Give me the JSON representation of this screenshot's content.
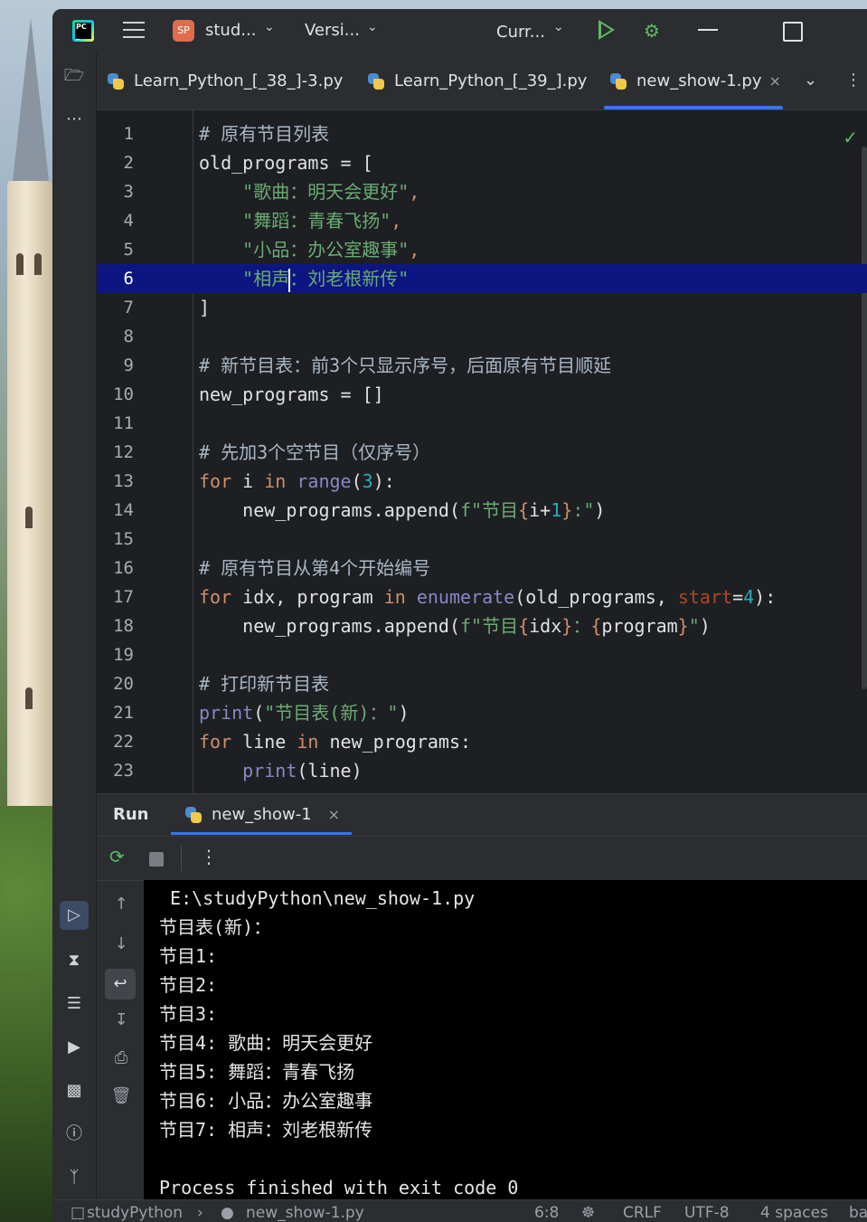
{
  "titlebar": {
    "project_badge": "SP",
    "project_name": "stud...",
    "vcs": "Versi...",
    "run_config": "Curr..."
  },
  "tabs": [
    {
      "label": "Learn_Python_[_38_]-3.py"
    },
    {
      "label": "Learn_Python_[_39_].py"
    },
    {
      "label": "new_show-1.py",
      "close": "×"
    }
  ],
  "editor": {
    "line_numbers": [
      "1",
      "2",
      "3",
      "4",
      "5",
      "6",
      "7",
      "8",
      "9",
      "10",
      "11",
      "12",
      "13",
      "14",
      "15",
      "16",
      "17",
      "18",
      "19",
      "20",
      "21",
      "22",
      "23"
    ],
    "current_line": 6,
    "code": {
      "l1_comment": "# 原有节目列表",
      "l2_a": "old_programs = [",
      "l3": "\"歌曲：明天会更好\"",
      "l3_comma": ",",
      "l4": "\"舞蹈：青春飞扬\"",
      "l4_comma": ",",
      "l5": "\"小品：办公室趣事\"",
      "l5_comma": ",",
      "l6_a": "\"相声",
      "l6_b": "：刘老根新传\"",
      "l7": "]",
      "l9_comment": "# 新节目表：前3个只显示序号，后面原有节目顺延",
      "l10": "new_programs = []",
      "l12_comment": "# 先加3个空节目（仅序号）",
      "l13_kw": "for",
      "l13_var": " i ",
      "l13_in": "in",
      "l13_sp": " ",
      "l13_range": "range",
      "l13_open": "(",
      "l13_num": "3",
      "l13_close": "):",
      "l14_call": "new_programs.append(",
      "l14_f": "f\"节目",
      "l14_brace_open": "{",
      "l14_expr": "i+",
      "l14_num": "1",
      "l14_brace_close": "}",
      "l14_end": ":\"",
      "l14_paren": ")",
      "l16_comment": "# 原有节目从第4个开始编号",
      "l17_kw": "for",
      "l17_vars": " idx, program ",
      "l17_in": "in",
      "l17_sp": " ",
      "l17_enum": "enumerate",
      "l17_args": "(old_programs, ",
      "l17_param": "start",
      "l17_eq": "=",
      "l17_num": "4",
      "l17_close": "):",
      "l18_call": "new_programs.append(",
      "l18_f": "f\"节目",
      "l18_b1": "{",
      "l18_e1": "idx",
      "l18_b2": "}",
      "l18_colon": "：",
      "l18_b3": "{",
      "l18_e2": "program",
      "l18_b4": "}",
      "l18_q": "\"",
      "l18_paren": ")",
      "l20_comment": "# 打印新节目表",
      "l21_print": "print",
      "l21_open": "(",
      "l21_str": "\"节目表(新)：\"",
      "l21_close": ")",
      "l22_kw": "for",
      "l22_var": " line ",
      "l22_in": "in",
      "l22_rest": " new_programs:",
      "l23_print": "print",
      "l23_args": "(line)"
    }
  },
  "run": {
    "title": "Run",
    "tab_label": "new_show-1",
    "tab_close": "×",
    "output": [
      " E:\\studyPython\\new_show-1.py",
      "节目表(新)：",
      "节目1:",
      "节目2:",
      "节目3:",
      "节目4: 歌曲：明天会更好",
      "节目5: 舞蹈：青春飞扬",
      "节目6: 小品：办公室趣事",
      "节目7: 相声：刘老根新传",
      "",
      "Process finished with exit code 0"
    ]
  },
  "statusbar": {
    "project": "studyPython",
    "file": "new_show-1.py",
    "position": "6:8",
    "line_sep": "CRLF",
    "encoding": "UTF-8",
    "indent": "4 spaces",
    "extra": "ba"
  },
  "colors": {
    "accent": "#3574f0",
    "current_line": "#0d1680",
    "keyword": "#cf8e6d",
    "string": "#6aab73",
    "number": "#2aacb8",
    "run_green": "#5fb865"
  }
}
